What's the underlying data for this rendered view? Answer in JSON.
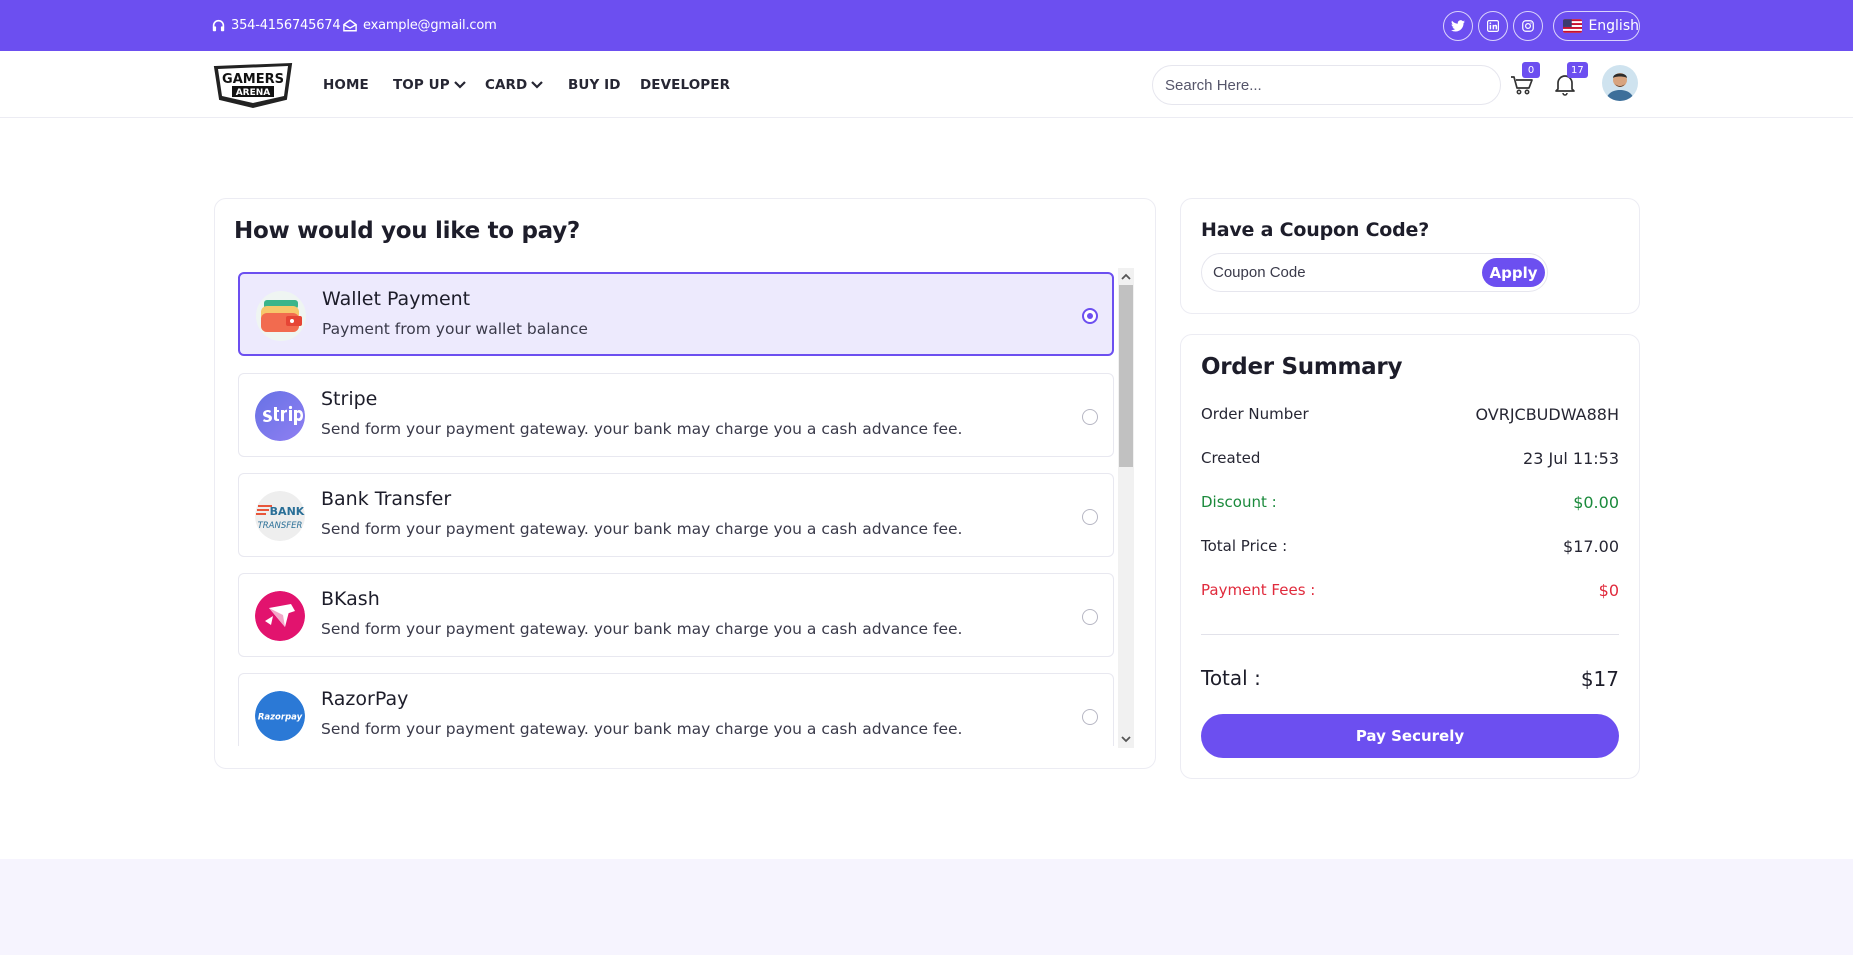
{
  "topbar": {
    "phone": "354-4156745674",
    "email": "example@gmail.com",
    "language": "English"
  },
  "nav": {
    "home": "HOME",
    "topup": "TOP UP",
    "card": "CARD",
    "buyid": "BUY ID",
    "developer": "DEVELOPER"
  },
  "header": {
    "logo_text": "GAMERS ARENA",
    "search_placeholder": "Search Here...",
    "cart_count": "0",
    "notification_count": "17"
  },
  "payment": {
    "title": "How would you like to pay?",
    "selected_index": 0,
    "methods": [
      {
        "name": "Wallet Payment",
        "desc": "Payment from your wallet balance",
        "icon": "wallet-icon"
      },
      {
        "name": "Stripe",
        "desc": "Send form your payment gateway. your bank may charge you a cash advance fee.",
        "icon": "stripe-logo"
      },
      {
        "name": "Bank Transfer",
        "desc": "Send form your payment gateway. your bank may charge you a cash advance fee.",
        "icon": "bank-transfer-logo"
      },
      {
        "name": "BKash",
        "desc": "Send form your payment gateway. your bank may charge you a cash advance fee.",
        "icon": "bkash-logo"
      },
      {
        "name": "RazorPay",
        "desc": "Send form your payment gateway. your bank may charge you a cash advance fee.",
        "icon": "razorpay-logo"
      }
    ]
  },
  "coupon": {
    "title": "Have a Coupon Code?",
    "placeholder": "Coupon Code",
    "apply_label": "Apply"
  },
  "summary": {
    "title": "Order Summary",
    "order_number_label": "Order Number",
    "order_number": "OVRJCBUDWA88H",
    "created_label": "Created",
    "created": "23 Jul 11:53",
    "discount_label": "Discount :",
    "discount": "$0.00",
    "total_price_label": "Total Price :",
    "total_price": "$17.00",
    "fees_label": "Payment Fees :",
    "fees": "$0",
    "total_label": "Total :",
    "total": "$17",
    "pay_label": "Pay Securely"
  },
  "colors": {
    "accent": "#6c4ff0",
    "discount": "#1b8a3c",
    "fees": "#e02a3c"
  }
}
